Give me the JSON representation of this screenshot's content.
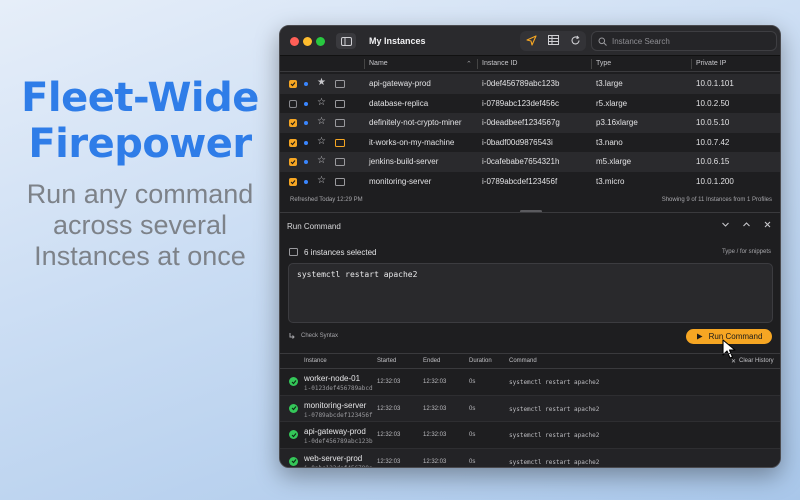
{
  "promo": {
    "title_line1": "Fleet-Wide",
    "title_line2": "Firepower",
    "subtitle_line1": "Run any command",
    "subtitle_line2": "across several",
    "subtitle_line3": "Instances at once"
  },
  "window": {
    "title": "My Instances",
    "search_placeholder": "Instance Search"
  },
  "table": {
    "columns": {
      "name": "Name",
      "instance_id": "Instance ID",
      "type": "Type",
      "private_ip": "Private IP"
    },
    "rows": [
      {
        "checked": true,
        "name": "api-gateway-prod",
        "id": "i-0def456789abc123b",
        "type": "t3.large",
        "ip": "10.0.1.101"
      },
      {
        "checked": false,
        "name": "database-replica",
        "id": "i-0789abc123def456c",
        "type": "r5.xlarge",
        "ip": "10.0.2.50"
      },
      {
        "checked": true,
        "name": "definitely-not-crypto-miner",
        "id": "i-0deadbeef1234567g",
        "type": "p3.16xlarge",
        "ip": "10.0.5.10"
      },
      {
        "checked": true,
        "name": "it-works-on-my-machine",
        "id": "i-0badf00d9876543i",
        "type": "t3.nano",
        "ip": "10.0.7.42"
      },
      {
        "checked": true,
        "name": "jenkins-build-server",
        "id": "i-0cafebabe7654321h",
        "type": "m5.xlarge",
        "ip": "10.0.6.15"
      },
      {
        "checked": true,
        "name": "monitoring-server",
        "id": "i-0789abcdef123456f",
        "type": "t3.micro",
        "ip": "10.0.1.200"
      }
    ],
    "refreshed": "Refreshed Today 12:29 PM",
    "showing": "Showing 9 of 11 Instances from 1 Profiles"
  },
  "run_command": {
    "title": "Run Command",
    "selected": "6 instances selected",
    "hint": "Type / for snippets",
    "command": "systemctl restart apache2",
    "check_syntax": "Check Syntax",
    "run_label": "Run Command"
  },
  "history": {
    "columns": {
      "instance": "Instance",
      "started": "Started",
      "ended": "Ended",
      "duration": "Duration",
      "command": "Command",
      "clear": "Clear History"
    },
    "rows": [
      {
        "name": "worker-node-01",
        "id": "i-0123def456789abcd",
        "started": "12:32:03",
        "ended": "12:32:03",
        "duration": "0s",
        "command": "systemctl restart apache2"
      },
      {
        "name": "monitoring-server",
        "id": "i-0789abcdef123456f",
        "started": "12:32:03",
        "ended": "12:32:03",
        "duration": "0s",
        "command": "systemctl restart apache2"
      },
      {
        "name": "api-gateway-prod",
        "id": "i-0def456789abc123b",
        "started": "12:32:03",
        "ended": "12:32:03",
        "duration": "0s",
        "command": "systemctl restart apache2"
      },
      {
        "name": "web-server-prod",
        "id": "i-0abc123def456789a",
        "started": "12:32:03",
        "ended": "12:32:03",
        "duration": "0s",
        "command": "systemctl restart apache2"
      }
    ]
  },
  "colors": {
    "accent": "#f6a623",
    "promo_blue": "#2f7de8",
    "success": "#34c759"
  }
}
